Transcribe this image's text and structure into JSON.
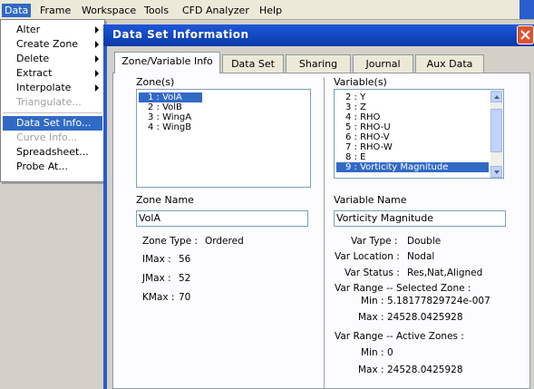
{
  "menubar": {
    "items": [
      {
        "label": "Data"
      },
      {
        "label": "Frame"
      },
      {
        "label": "Workspace"
      },
      {
        "label": "Tools"
      },
      {
        "label": "CFD Analyzer"
      },
      {
        "label": "Help"
      }
    ]
  },
  "data_menu": {
    "items": [
      {
        "label": "Alter"
      },
      {
        "label": "Create Zone"
      },
      {
        "label": "Delete"
      },
      {
        "label": "Extract"
      },
      {
        "label": "Interpolate"
      },
      {
        "label": "Triangulate..."
      },
      {
        "label": "Data Set Info..."
      },
      {
        "label": "Curve Info..."
      },
      {
        "label": "Spreadsheet..."
      },
      {
        "label": "Probe At..."
      }
    ]
  },
  "dialog": {
    "title": "Data Set Information",
    "tabs": [
      {
        "label": "Zone/Variable Info"
      },
      {
        "label": "Data Set"
      },
      {
        "label": "Sharing"
      },
      {
        "label": "Journal"
      },
      {
        "label": "Aux Data"
      }
    ],
    "zones": {
      "header": "Zone(s)",
      "items": [
        "1 : VolA",
        "2 : VolB",
        "3 : WingA",
        "4 : WingB"
      ],
      "name_label": "Zone Name",
      "name_value": "VolA",
      "zone_type_label": "Zone Type :",
      "zone_type_value": "Ordered",
      "imax_label": "IMax :",
      "imax_value": "56",
      "jmax_label": "JMax :",
      "jmax_value": "52",
      "kmax_label": "KMax :",
      "kmax_value": "70"
    },
    "variables": {
      "header": "Variable(s)",
      "items": [
        "2 : Y",
        "3 : Z",
        "4 : RHO",
        "5 : RHO-U",
        "6 : RHO-V",
        "7 : RHO-W",
        "8 : E",
        "9 : Vorticity Magnitude"
      ],
      "name_label": "Variable Name",
      "name_value": "Vorticity Magnitude",
      "var_type_label": "Var Type :",
      "var_type_value": "Double",
      "var_location_label": "Var Location :",
      "var_location_value": "Nodal",
      "var_status_label": "Var Status :",
      "var_status_value": "Res,Nat,Aligned",
      "selected_zone_header": "Var Range -- Selected Zone :",
      "selected_min_label": "Min :",
      "selected_min_value": "5.18177829724e-007",
      "selected_max_label": "Max :",
      "selected_max_value": "24528.0425928",
      "active_zones_header": "Var Range -- Active Zones :",
      "active_min_label": "Min :",
      "active_min_value": "0",
      "active_max_label": "Max :",
      "active_max_value": "24528.0425928"
    }
  }
}
